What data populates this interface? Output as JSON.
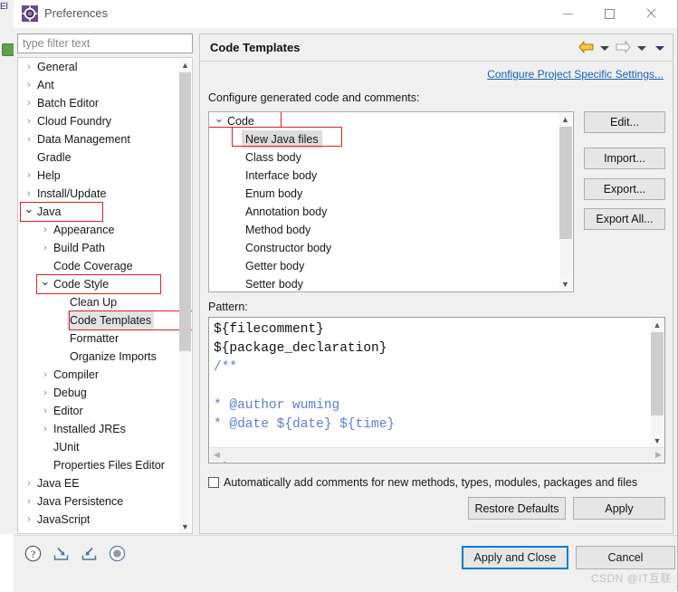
{
  "window": {
    "title": "Preferences",
    "icon": "eclipse-preferences-icon",
    "minimize_label": "",
    "maximize_label": "",
    "close_label": ""
  },
  "backdrop": {
    "tab_text": "El"
  },
  "filter": {
    "placeholder": "type filter text",
    "value": ""
  },
  "sidebar": {
    "items": [
      {
        "label": "General",
        "indent": 0,
        "arrow": "collapsed",
        "selected": false,
        "highlight": false
      },
      {
        "label": "Ant",
        "indent": 0,
        "arrow": "collapsed",
        "selected": false,
        "highlight": false
      },
      {
        "label": "Batch Editor",
        "indent": 0,
        "arrow": "collapsed",
        "selected": false,
        "highlight": false
      },
      {
        "label": "Cloud Foundry",
        "indent": 0,
        "arrow": "collapsed",
        "selected": false,
        "highlight": false
      },
      {
        "label": "Data Management",
        "indent": 0,
        "arrow": "collapsed",
        "selected": false,
        "highlight": false
      },
      {
        "label": "Gradle",
        "indent": 0,
        "arrow": "none",
        "selected": false,
        "highlight": false
      },
      {
        "label": "Help",
        "indent": 0,
        "arrow": "collapsed",
        "selected": false,
        "highlight": false
      },
      {
        "label": "Install/Update",
        "indent": 0,
        "arrow": "collapsed",
        "selected": false,
        "highlight": false
      },
      {
        "label": "Java",
        "indent": 0,
        "arrow": "expanded",
        "selected": false,
        "highlight": true
      },
      {
        "label": "Appearance",
        "indent": 1,
        "arrow": "collapsed",
        "selected": false,
        "highlight": false
      },
      {
        "label": "Build Path",
        "indent": 1,
        "arrow": "collapsed",
        "selected": false,
        "highlight": false
      },
      {
        "label": "Code Coverage",
        "indent": 1,
        "arrow": "none",
        "selected": false,
        "highlight": false
      },
      {
        "label": "Code Style",
        "indent": 1,
        "arrow": "expanded",
        "selected": false,
        "highlight": true
      },
      {
        "label": "Clean Up",
        "indent": 2,
        "arrow": "none",
        "selected": false,
        "highlight": false
      },
      {
        "label": "Code Templates",
        "indent": 2,
        "arrow": "none",
        "selected": true,
        "highlight": true
      },
      {
        "label": "Formatter",
        "indent": 2,
        "arrow": "none",
        "selected": false,
        "highlight": false
      },
      {
        "label": "Organize Imports",
        "indent": 2,
        "arrow": "none",
        "selected": false,
        "highlight": false
      },
      {
        "label": "Compiler",
        "indent": 1,
        "arrow": "collapsed",
        "selected": false,
        "highlight": false
      },
      {
        "label": "Debug",
        "indent": 1,
        "arrow": "collapsed",
        "selected": false,
        "highlight": false
      },
      {
        "label": "Editor",
        "indent": 1,
        "arrow": "collapsed",
        "selected": false,
        "highlight": false
      },
      {
        "label": "Installed JREs",
        "indent": 1,
        "arrow": "collapsed",
        "selected": false,
        "highlight": false
      },
      {
        "label": "JUnit",
        "indent": 1,
        "arrow": "none",
        "selected": false,
        "highlight": false
      },
      {
        "label": "Properties Files Editor",
        "indent": 1,
        "arrow": "none",
        "selected": false,
        "highlight": false
      },
      {
        "label": "Java EE",
        "indent": 0,
        "arrow": "collapsed",
        "selected": false,
        "highlight": false
      },
      {
        "label": "Java Persistence",
        "indent": 0,
        "arrow": "collapsed",
        "selected": false,
        "highlight": false
      },
      {
        "label": "JavaScript",
        "indent": 0,
        "arrow": "collapsed",
        "selected": false,
        "highlight": false
      }
    ]
  },
  "pane": {
    "title": "Code Templates",
    "nav": {
      "back_icon": "back-arrow-icon",
      "back_menu_icon": "chevron-down-icon",
      "forward_icon": "forward-arrow-icon",
      "forward_menu_icon": "chevron-down-icon",
      "overflow_icon": "chevron-down-icon"
    },
    "configure_link": "Configure Project Specific Settings...",
    "configure_label": "Configure generated code and comments:"
  },
  "code_tree": {
    "items": [
      {
        "label": "Code",
        "indent": 0,
        "arrow": "expanded",
        "selected": false,
        "highlight": true
      },
      {
        "label": "New Java files",
        "indent": 1,
        "arrow": "none",
        "selected": true,
        "highlight": true
      },
      {
        "label": "Class body",
        "indent": 1,
        "arrow": "none",
        "selected": false,
        "highlight": false
      },
      {
        "label": "Interface body",
        "indent": 1,
        "arrow": "none",
        "selected": false,
        "highlight": false
      },
      {
        "label": "Enum body",
        "indent": 1,
        "arrow": "none",
        "selected": false,
        "highlight": false
      },
      {
        "label": "Annotation body",
        "indent": 1,
        "arrow": "none",
        "selected": false,
        "highlight": false
      },
      {
        "label": "Method body",
        "indent": 1,
        "arrow": "none",
        "selected": false,
        "highlight": false
      },
      {
        "label": "Constructor body",
        "indent": 1,
        "arrow": "none",
        "selected": false,
        "highlight": false
      },
      {
        "label": "Getter body",
        "indent": 1,
        "arrow": "none",
        "selected": false,
        "highlight": false
      },
      {
        "label": "Setter body",
        "indent": 1,
        "arrow": "none",
        "selected": false,
        "highlight": false
      }
    ]
  },
  "side_buttons": {
    "edit": "Edit...",
    "import": "Import...",
    "export": "Export...",
    "export_all": "Export All..."
  },
  "pattern": {
    "label": "Pattern:",
    "lines": [
      {
        "text": "${filecomment}",
        "comment": false
      },
      {
        "text": "${package_declaration}",
        "comment": false
      },
      {
        "text": "/**",
        "comment": true
      },
      {
        "text": "",
        "comment": true
      },
      {
        "text": "* @author wuming",
        "comment": true
      },
      {
        "text": "* @date ${date} ${time}",
        "comment": true
      },
      {
        "text": "",
        "comment": true
      },
      {
        "text": "*/",
        "comment": true
      }
    ]
  },
  "options": {
    "auto_comments_label": "Automatically add comments for new methods, types, modules, packages and files",
    "auto_comments_checked": false
  },
  "bottom_buttons": {
    "restore_defaults": "Restore Defaults",
    "apply": "Apply"
  },
  "footer": {
    "icons": [
      {
        "name": "help-icon"
      },
      {
        "name": "import-preferences-icon"
      },
      {
        "name": "export-preferences-icon"
      },
      {
        "name": "record-icon"
      }
    ],
    "apply_and_close": "Apply and Close",
    "cancel": "Cancel",
    "watermark": "CSDN @IT互联"
  },
  "colors": {
    "annotation_red": "#e02020",
    "link_blue": "#1a5fb4",
    "focus_blue": "#0a7bd0",
    "selection_gray": "#dcdcdc",
    "comment_blue": "#5a7fd4",
    "back_arrow_gold": "#d9a400"
  }
}
